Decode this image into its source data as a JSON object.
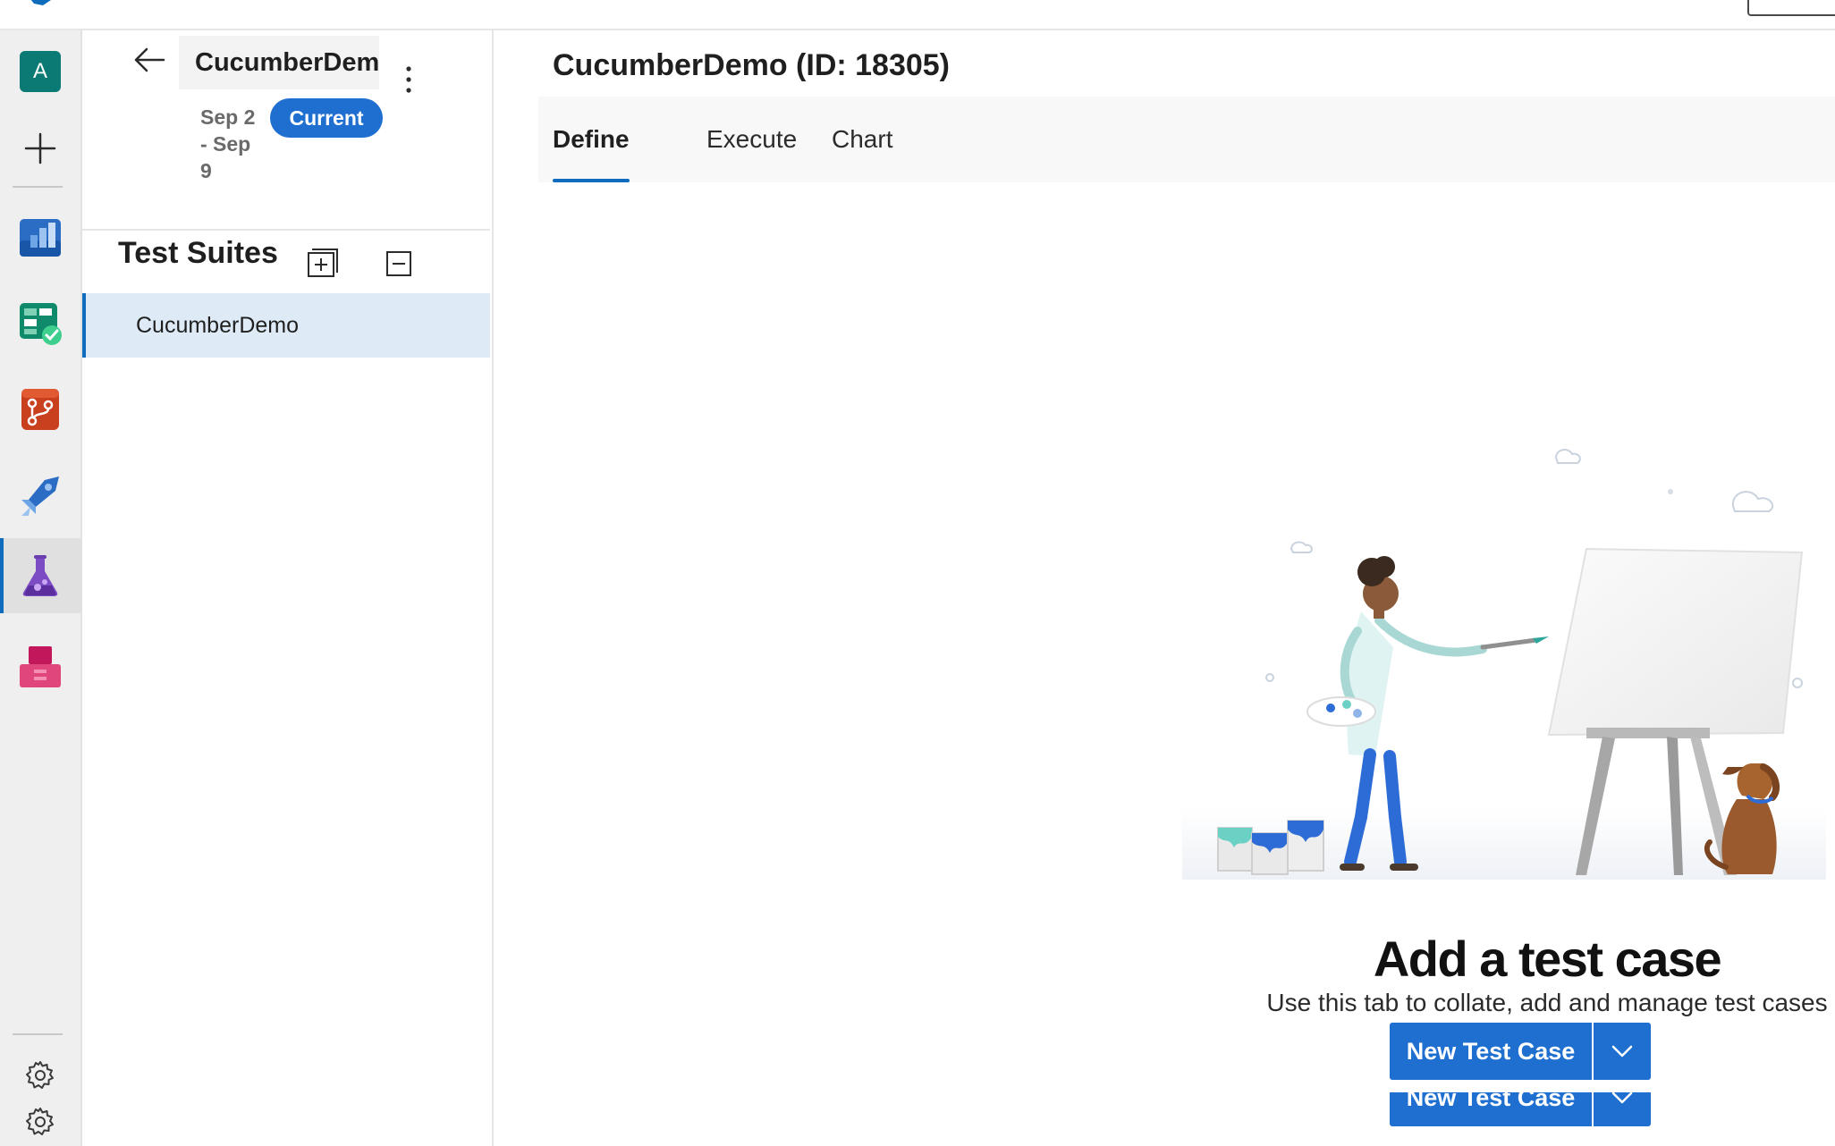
{
  "rail": {
    "avatar_letter": "A",
    "items": [
      {
        "name": "overview",
        "icon": "overview-icon"
      },
      {
        "name": "boards",
        "icon": "boards-icon"
      },
      {
        "name": "repos",
        "icon": "repos-icon"
      },
      {
        "name": "pipelines",
        "icon": "pipelines-icon"
      },
      {
        "name": "test-plans",
        "icon": "test-plans-icon",
        "active": true
      },
      {
        "name": "artifacts",
        "icon": "artifacts-icon"
      }
    ]
  },
  "sidebar": {
    "plan_name": "CucumberDemo",
    "dates": "Sep 2 - Sep 9",
    "status_badge": "Current",
    "suites_title": "Test Suites",
    "suites": [
      "CucumberDemo"
    ]
  },
  "main": {
    "title": "CucumberDemo (ID: 18305)",
    "tabs": [
      {
        "label": "Define",
        "active": true
      },
      {
        "label": "Execute",
        "active": false
      },
      {
        "label": "Chart",
        "active": false
      }
    ],
    "empty_state": {
      "title": "Add a test case",
      "subtitle": "Use this tab to collate, add and manage test cases",
      "button_label": "New Test Case",
      "ghost_button_label": "New Test Case"
    }
  },
  "colors": {
    "accent": "#1f6fd1",
    "selected_bg": "#deebf7",
    "rail_bg": "#efefef"
  }
}
